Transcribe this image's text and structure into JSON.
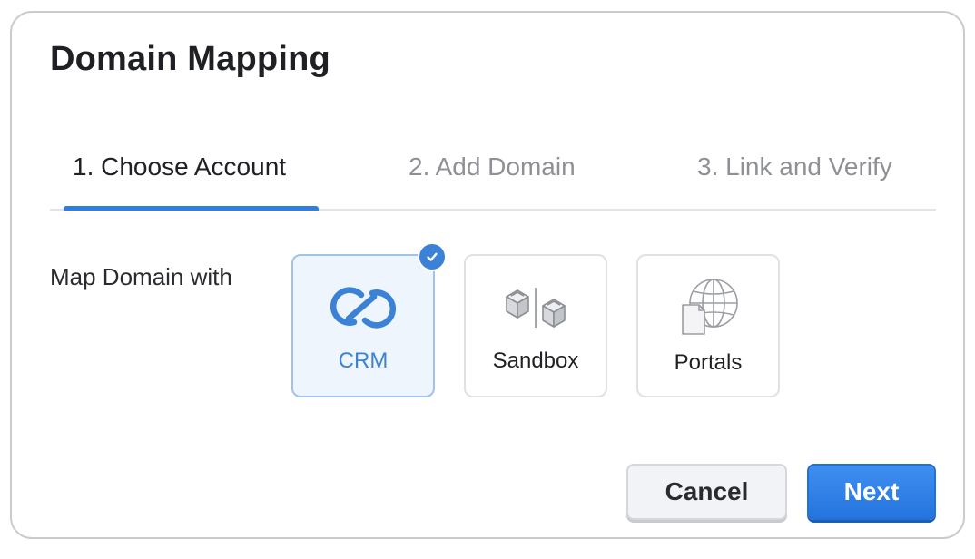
{
  "dialog": {
    "title": "Domain Mapping"
  },
  "tabs": [
    {
      "label": "1. Choose Account",
      "active": true
    },
    {
      "label": "2. Add Domain",
      "active": false
    },
    {
      "label": "3. Link and Verify",
      "active": false
    }
  ],
  "map_domain": {
    "label": "Map Domain with",
    "options": [
      {
        "label": "CRM",
        "icon": "crm-icon",
        "selected": true
      },
      {
        "label": "Sandbox",
        "icon": "sandbox-icon",
        "selected": false
      },
      {
        "label": "Portals",
        "icon": "portals-icon",
        "selected": false
      }
    ]
  },
  "footer": {
    "cancel_label": "Cancel",
    "next_label": "Next"
  },
  "colors": {
    "accent": "#2f7de1",
    "selected_card_bg": "#eef5fd",
    "selected_card_border": "#9fc3ea",
    "next_button": "#2f7de1"
  }
}
